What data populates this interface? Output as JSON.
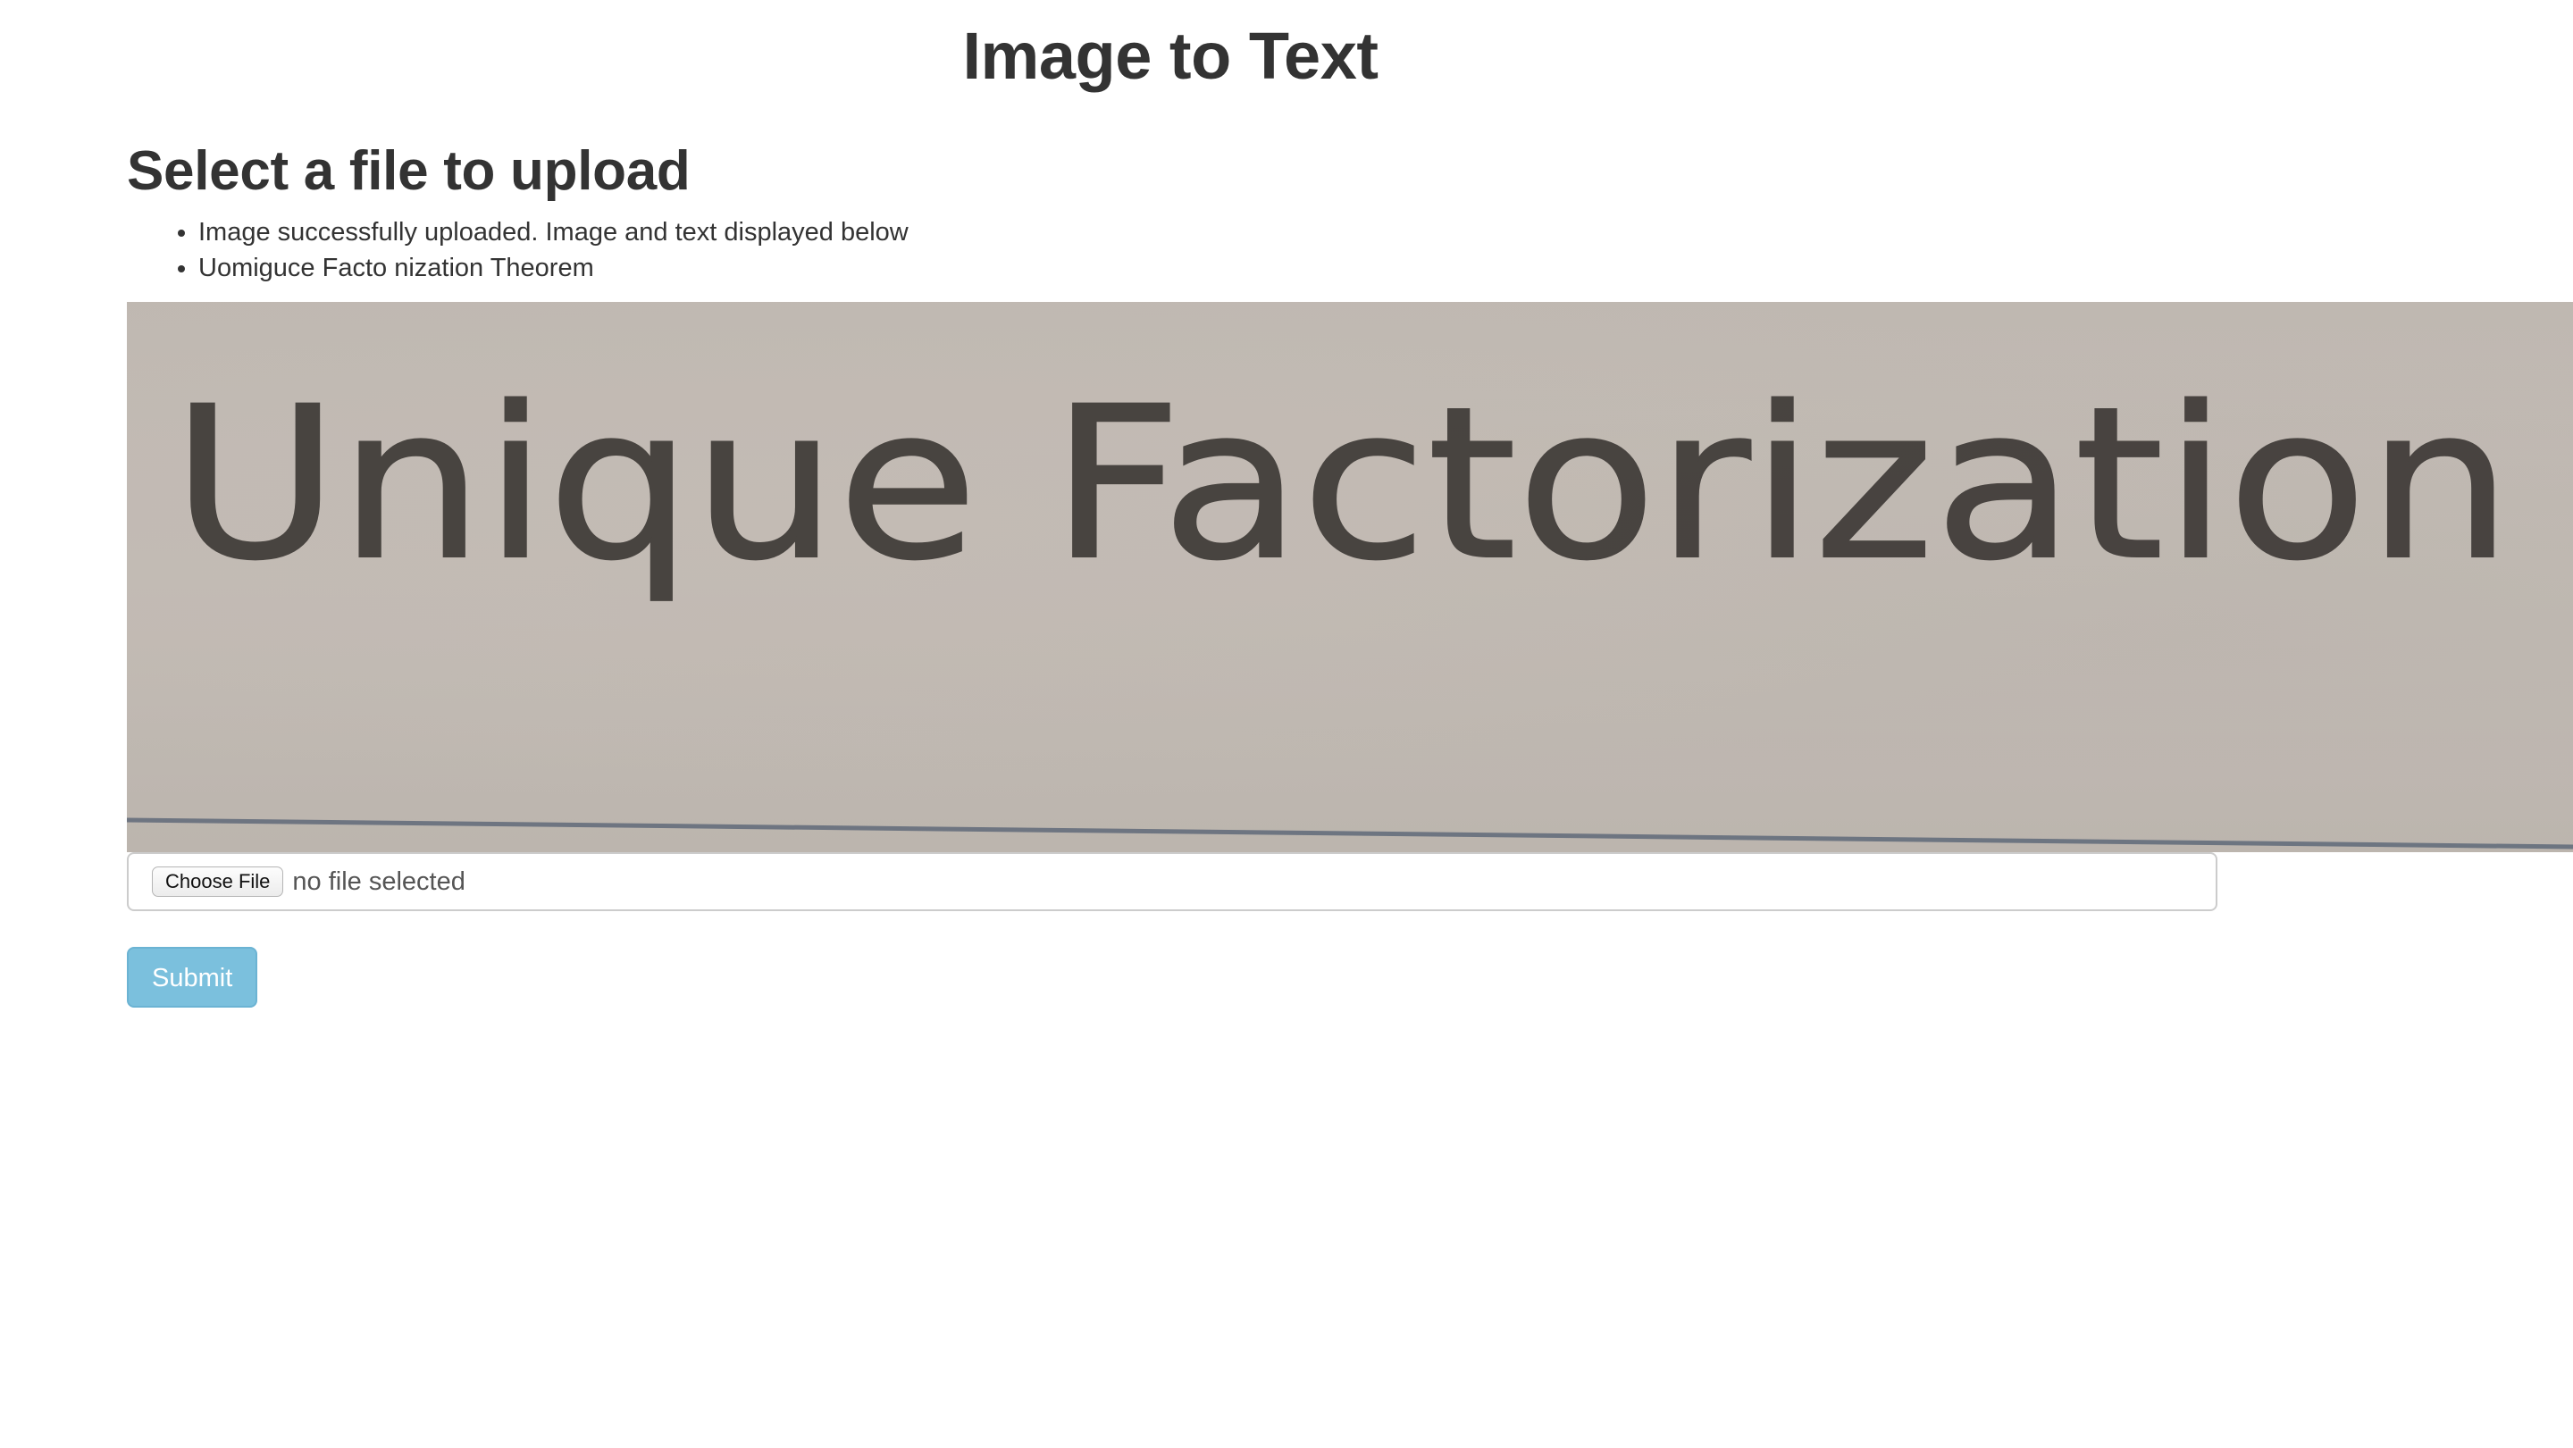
{
  "header": {
    "title": "Image to Text"
  },
  "upload": {
    "section_title": "Select a file to upload",
    "messages": [
      "Image successfully uploaded. Image and text displayed below",
      "Uomiguce Facto nization Theorem"
    ],
    "image_text": "Unique Factorization",
    "choose_file_label": "Choose File",
    "file_status": "no file selected",
    "submit_label": "Submit"
  },
  "colors": {
    "text": "#333333",
    "submit_bg": "#7bc0dd",
    "image_bg": "#c0b9b2",
    "ink": "#3e3a37"
  }
}
